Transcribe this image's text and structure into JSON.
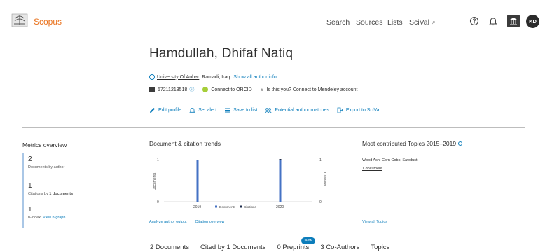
{
  "header": {
    "brand": "Scopus",
    "nav": {
      "search": "Search",
      "sources": "Sources",
      "lists": "Lists",
      "scival": "SciVal",
      "scival_ext": "↗"
    },
    "avatar_initials": "KD"
  },
  "author": {
    "name": "Hamdullah, Dhifaf Natiq",
    "affiliation_org": "University Of Anbar",
    "affiliation_place": ", Ramadi, Iraq",
    "show_all_info": "Show all author info",
    "scopus_id": "57211213518",
    "connect_orcid": "Connect to ORCID",
    "mendeley": "Is this you? Connect to Mendeley account"
  },
  "actions": {
    "edit_profile": "Edit profile",
    "set_alert": "Set alert",
    "save_to_list": "Save to list",
    "potential_matches": "Potential author matches",
    "export_scival": "Export to SciVal"
  },
  "metrics": {
    "title": "Metrics overview",
    "documents_value": "2",
    "documents_label": "Documents by author",
    "citations_value": "1",
    "citations_label_prefix": "Citations by ",
    "citations_label_bold": "1 documents",
    "hindex_value": "1",
    "hindex_label": "h-index:",
    "hindex_link": "View h-graph"
  },
  "trends": {
    "title": "Document & citation trends",
    "analyze_link": "Analyze author output",
    "citation_link": "Citation overview"
  },
  "chart_data": {
    "type": "bar",
    "title": "Document & citation trends",
    "categories": [
      "2019",
      "2020"
    ],
    "series": [
      {
        "name": "Documents",
        "values": [
          1,
          1
        ],
        "color": "#4472c4"
      },
      {
        "name": "Citations",
        "values": [
          0,
          1
        ],
        "color": "#1f2d4d"
      }
    ],
    "ylabel_left": "Documents",
    "ylabel_right": "Citations",
    "y_ticks_left": [
      "1",
      "0"
    ],
    "y_ticks_right": [
      "1",
      "0"
    ],
    "ylim": [
      0,
      1
    ],
    "legend": "bottom-center"
  },
  "topics": {
    "title": "Most contributed Topics 2015–2019",
    "topic_name": "Wood Ash; Corn Cobs; Sawdust",
    "topic_docs": "1 document",
    "view_all": "View all Topics"
  },
  "tabs": [
    {
      "label": "2 Documents"
    },
    {
      "label": "Cited by 1 Documents"
    },
    {
      "label": "0 Preprints"
    },
    {
      "label": "3 Co-Authors"
    },
    {
      "label": "Topics"
    }
  ],
  "new_badge": "New",
  "colors": {
    "brand": "#e9711c",
    "link": "#0c7dbb",
    "documents_bar": "#4472c4",
    "citations_marker": "#1f2d4d"
  }
}
